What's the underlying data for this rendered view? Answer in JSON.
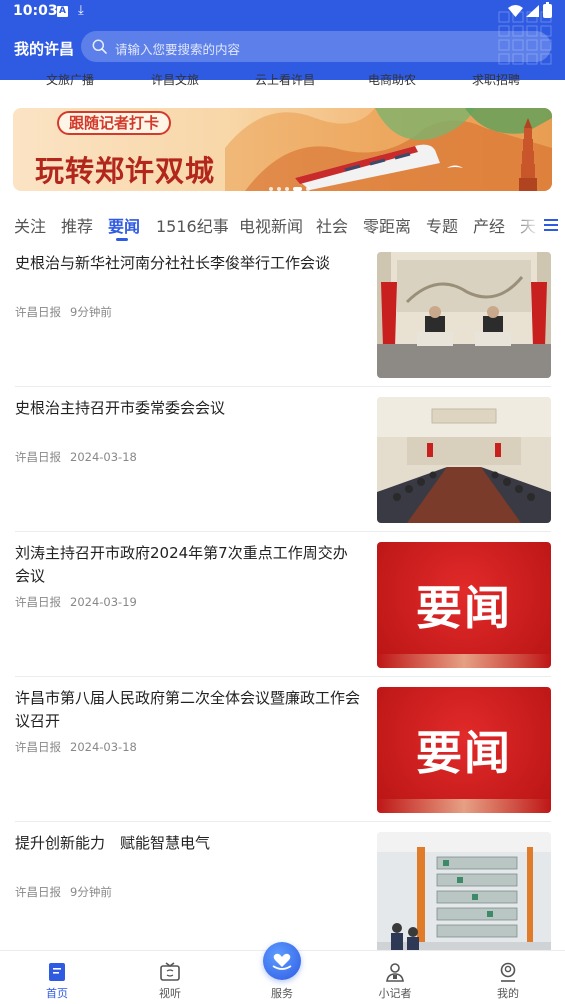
{
  "status_bar": {
    "time": "10:03"
  },
  "header": {
    "app_title": "我的许昌",
    "search_placeholder": "请输入您要搜索的内容"
  },
  "subnav": [
    "文旅广播",
    "许昌文旅",
    "云上看许昌",
    "电商助农",
    "求职招聘"
  ],
  "banner": {
    "tag": "跟随记者打卡",
    "title": "玩转郑许双城"
  },
  "tabs": [
    "关注",
    "推荐",
    "要闻",
    "1516纪事",
    "电视新闻",
    "社会",
    "零距离",
    "专题",
    "产经",
    "天下"
  ],
  "active_tab": "要闻",
  "news": [
    {
      "headline": "史根治与新华社河南分社社长李俊举行工作会谈",
      "source": "许昌日报",
      "time": "9分钟前",
      "thumb": "meeting-photo"
    },
    {
      "headline": "史根治主持召开市委常委会会议",
      "source": "许昌日报",
      "time": "2024-03-18",
      "thumb": "conference-photo"
    },
    {
      "headline": "刘涛主持召开市政府2024年第7次重点工作周交办会议",
      "source": "许昌日报",
      "time": "2024-03-19",
      "thumb": "yaowen-card",
      "thumb_text": "要闻"
    },
    {
      "headline": "许昌市第八届人民政府第二次全体会议暨廉政工作会议召开",
      "source": "许昌日报",
      "time": "2024-03-18",
      "thumb": "yaowen-card",
      "thumb_text": "要闻"
    },
    {
      "headline": "提升创新能力　赋能智慧电气",
      "source": "许昌日报",
      "time": "9分钟前",
      "thumb": "factory-photo"
    }
  ],
  "bottom_nav": [
    {
      "label": "首页",
      "icon": "home-icon",
      "active": true
    },
    {
      "label": "视听",
      "icon": "tv-icon",
      "active": false
    },
    {
      "label": "服务",
      "icon": "heart-hand-icon",
      "active": false
    },
    {
      "label": "小记者",
      "icon": "reporter-icon",
      "active": false
    },
    {
      "label": "我的",
      "icon": "profile-icon",
      "active": false
    }
  ],
  "colors": {
    "brand": "#2f5be3",
    "banner_red": "#b2261c",
    "yaowen_red": "#cc1d1d",
    "muted": "#888888"
  }
}
